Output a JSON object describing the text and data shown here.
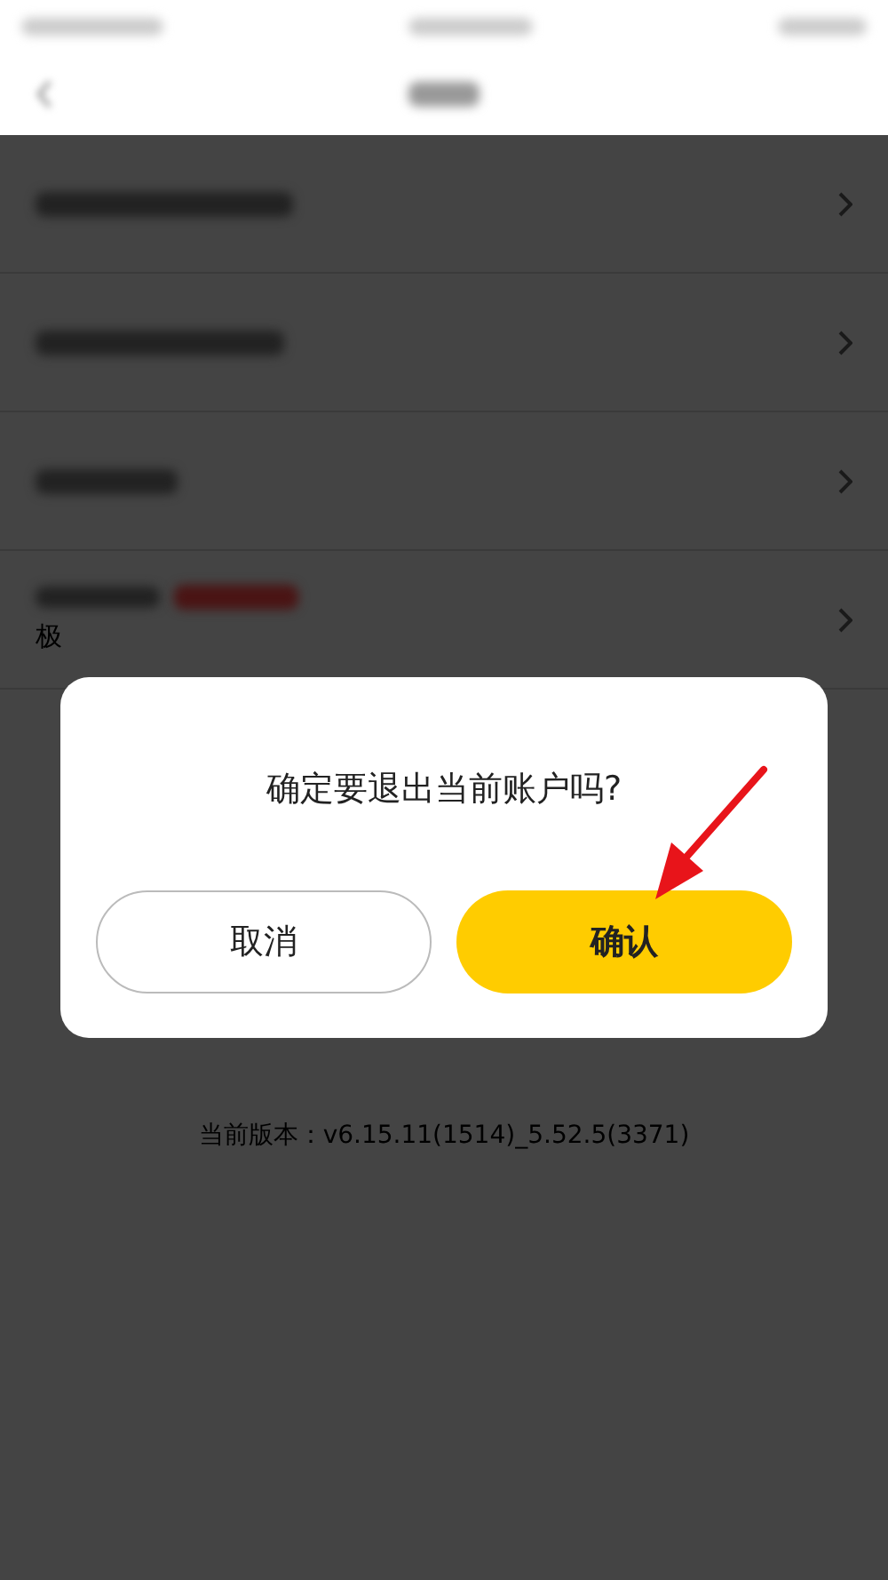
{
  "settings_list": {
    "rows": [
      {
        "kind": "plain"
      },
      {
        "kind": "plain"
      },
      {
        "kind": "plain"
      },
      {
        "kind": "tagged",
        "subtitle": "极"
      }
    ]
  },
  "version": "当前版本：v6.15.11(1514)_5.52.5(3371)",
  "dialog": {
    "message": "确定要退出当前账户吗?",
    "buttons": [
      {
        "label": "取消",
        "kind": "secondary"
      },
      {
        "label": "确认",
        "kind": "primary"
      }
    ]
  }
}
